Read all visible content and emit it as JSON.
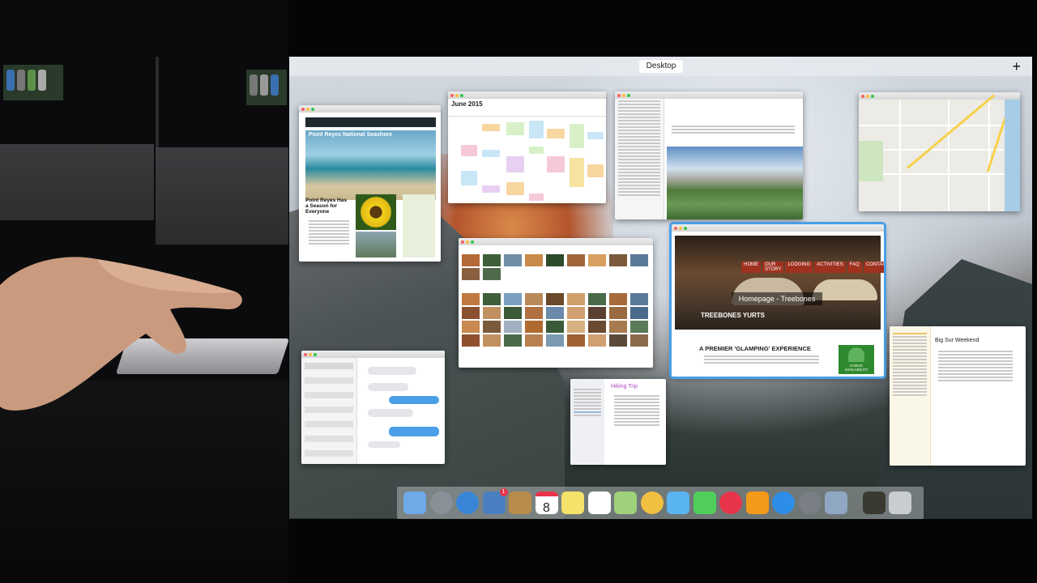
{
  "desktop": {
    "title": "Desktop",
    "add_space": "+"
  },
  "windows": {
    "mail": {
      "newsletter_title": "Point Reyes National Seashore",
      "headline": "Point Reyes Has a Season for Everyone"
    },
    "calendar": {
      "month": "June 2015"
    },
    "web": {
      "nav": [
        "HOME",
        "OUR STORY",
        "LODGING",
        "ACTIVITIES",
        "FAQ",
        "CONTACT"
      ],
      "overlay_title": "Homepage - Treebones",
      "site_name": "TREEBONES YURTS",
      "tagline": "A PREMIER 'GLAMPING' EXPERIENCE",
      "availability_button": "CHECK AVAILABILITY"
    },
    "reminders": {
      "title": "Hiking Trip"
    },
    "notes": {
      "title": "Big Sur Weekend"
    }
  },
  "dock": {
    "apps": [
      "finder-icon",
      "launchpad-icon",
      "safari-icon",
      "mail-icon",
      "contacts-icon",
      "calendar-icon",
      "notes-icon",
      "reminders-icon",
      "maps-icon",
      "photos-icon",
      "messages-icon",
      "facetime-icon",
      "itunes-icon",
      "ibooks-icon",
      "app-store-icon",
      "system-preferences-icon",
      "preview-icon",
      "photo-folder-icon",
      "trash-icon"
    ],
    "calendar_date": "8",
    "mail_badge": "1"
  },
  "colors": {
    "dock_bg": "#c8cdd2",
    "selection": "#4a9fe8"
  }
}
